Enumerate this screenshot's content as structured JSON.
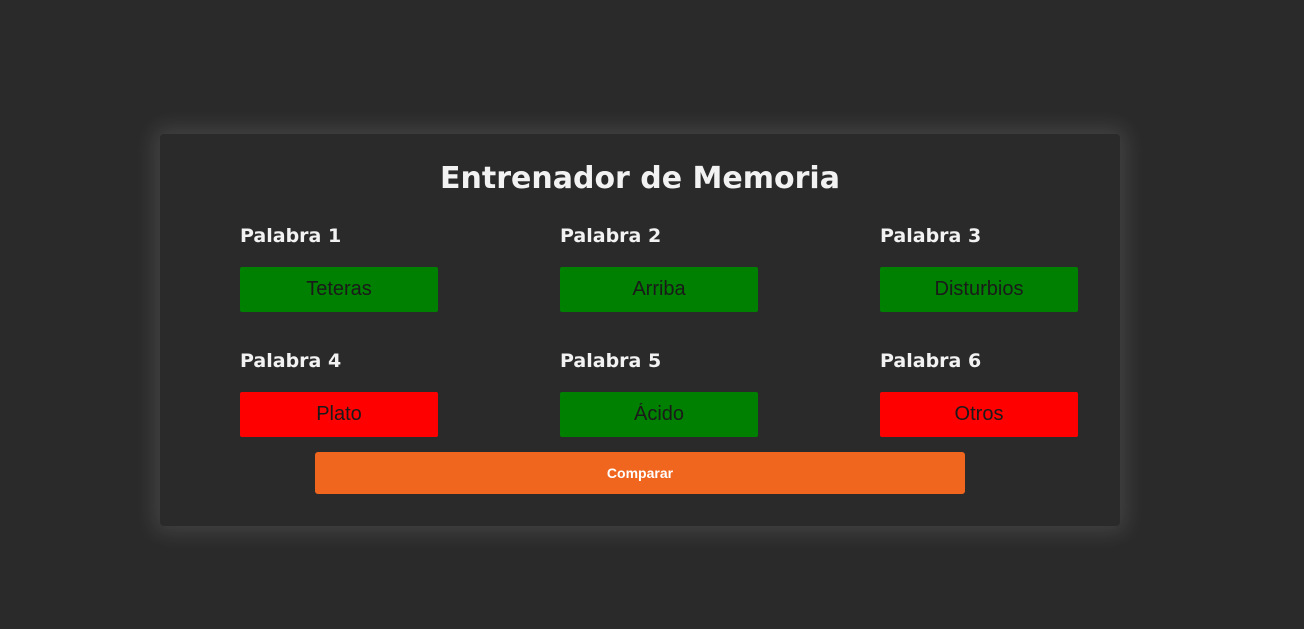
{
  "title": "Entrenador de Memoria",
  "colors": {
    "background": "#2a2a2a",
    "correct": "#008000",
    "incorrect": "#ff0000",
    "accent": "#f0661e"
  },
  "words": [
    {
      "label": "Palabra 1",
      "value": "Teteras",
      "status": "correct"
    },
    {
      "label": "Palabra 2",
      "value": "Arriba",
      "status": "correct"
    },
    {
      "label": "Palabra 3",
      "value": "Disturbios",
      "status": "correct"
    },
    {
      "label": "Palabra 4",
      "value": "Plato",
      "status": "incorrect"
    },
    {
      "label": "Palabra 5",
      "value": "Ácido",
      "status": "correct"
    },
    {
      "label": "Palabra 6",
      "value": "Otros",
      "status": "incorrect"
    }
  ],
  "compare_button": {
    "label": "Comparar"
  }
}
